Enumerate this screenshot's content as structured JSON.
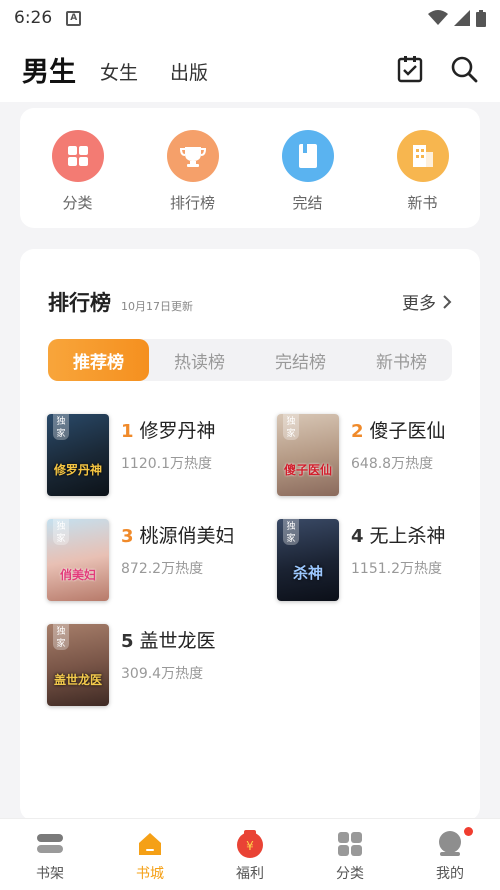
{
  "status": {
    "time": "6:26",
    "app_badge": "A"
  },
  "top_nav": {
    "tabs": [
      {
        "label": "男生",
        "active": true
      },
      {
        "label": "女生",
        "active": false
      },
      {
        "label": "出版",
        "active": false
      }
    ],
    "icons": [
      "calendar-check-icon",
      "search-icon"
    ]
  },
  "quick": {
    "items": [
      {
        "label": "分类",
        "icon": "category-icon",
        "color": "#f37b73"
      },
      {
        "label": "排行榜",
        "icon": "trophy-icon",
        "color": "#f5a06a"
      },
      {
        "label": "完结",
        "icon": "book-icon",
        "color": "#5ab3f0"
      },
      {
        "label": "新书",
        "icon": "building-icon",
        "color": "#f7b64f"
      }
    ]
  },
  "ranking": {
    "title": "排行榜",
    "date": "10月17日更新",
    "more": "更多",
    "tabs": [
      {
        "label": "推荐榜",
        "active": true
      },
      {
        "label": "热读榜",
        "active": false
      },
      {
        "label": "完结榜",
        "active": false
      },
      {
        "label": "新书榜",
        "active": false
      }
    ],
    "books": [
      {
        "rank": "1",
        "name": "修罗丹神",
        "heat": "1120.1万热度",
        "cover_tag": "独家",
        "cover_text": "修罗丹神"
      },
      {
        "rank": "2",
        "name": "傻子医仙",
        "heat": "648.8万热度",
        "cover_tag": "独家",
        "cover_text": "傻子医仙"
      },
      {
        "rank": "3",
        "name": "桃源俏美妇",
        "heat": "872.2万热度",
        "cover_tag": "独家",
        "cover_text": "俏美妇"
      },
      {
        "rank": "4",
        "name": "无上杀神",
        "heat": "1151.2万热度",
        "cover_tag": "独家",
        "cover_text": "杀神"
      },
      {
        "rank": "5",
        "name": "盖世龙医",
        "heat": "309.4万热度",
        "cover_tag": "独家",
        "cover_text": "盖世龙医"
      }
    ]
  },
  "bottom_nav": {
    "items": [
      {
        "label": "书架",
        "active": false
      },
      {
        "label": "书城",
        "active": true
      },
      {
        "label": "福利",
        "active": false
      },
      {
        "label": "分类",
        "active": false
      },
      {
        "label": "我的",
        "active": false
      }
    ],
    "accent_color": "#f5a016"
  }
}
